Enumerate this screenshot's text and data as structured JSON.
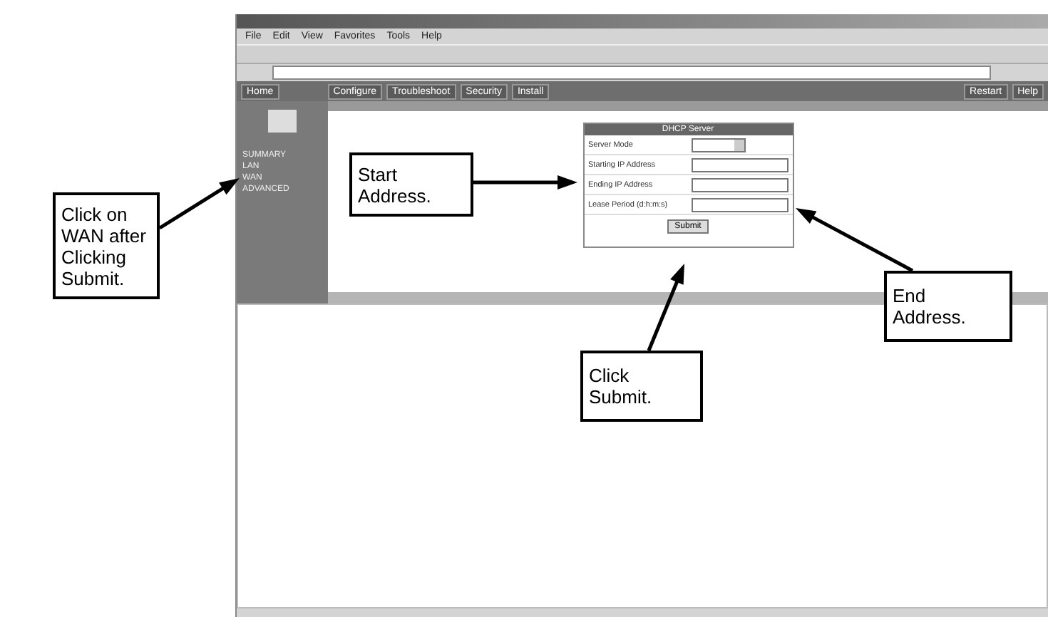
{
  "browser": {
    "menu": [
      "File",
      "Edit",
      "View",
      "Favorites",
      "Tools",
      "Help"
    ],
    "nav": {
      "home": "Home",
      "tabs": [
        "Configure",
        "Troubleshoot",
        "Security",
        "Install"
      ],
      "right": [
        "Restart",
        "Help"
      ]
    },
    "sidebar": [
      "SUMMARY",
      "LAN",
      "WAN",
      "ADVANCED"
    ],
    "form": {
      "title": "DHCP Server",
      "rows": [
        {
          "label": "Server Mode",
          "kind": "select"
        },
        {
          "label": "Starting IP Address",
          "kind": "input"
        },
        {
          "label": "Ending IP Address",
          "kind": "input"
        },
        {
          "label": "Lease Period (d:h:m:s)",
          "kind": "input"
        }
      ],
      "button": "Submit"
    }
  },
  "callouts": [
    {
      "text": "Click on WAN after Clicking Submit."
    },
    {
      "text": "Start Address."
    },
    {
      "text": "End Address."
    },
    {
      "text": "Click Submit."
    }
  ]
}
